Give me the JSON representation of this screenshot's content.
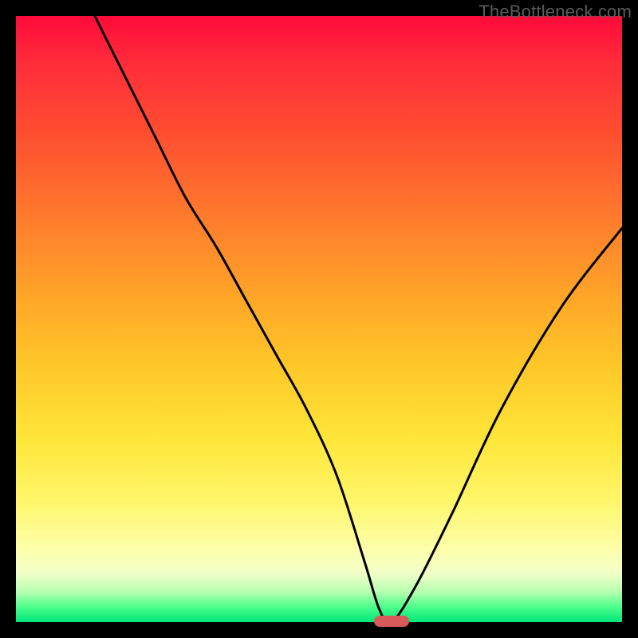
{
  "watermark": "TheBottleneck.com",
  "chart_data": {
    "type": "line",
    "title": "",
    "xlabel": "",
    "ylabel": "",
    "xlim": [
      0,
      100
    ],
    "ylim": [
      0,
      100
    ],
    "grid": false,
    "series": [
      {
        "name": "curve",
        "x": [
          13,
          18,
          23,
          28,
          33,
          38,
          43,
          48,
          53,
          57.5,
          60,
          62,
          66,
          72,
          80,
          90,
          100
        ],
        "y": [
          100,
          90,
          80,
          70,
          62,
          53,
          44,
          35,
          24,
          10,
          2,
          0,
          6,
          18,
          35,
          52,
          65
        ]
      }
    ],
    "marker": {
      "x": 62,
      "y": 0,
      "color": "#d95a5a"
    },
    "background_gradient": [
      "#ff0a3a",
      "#ff5030",
      "#ffa428",
      "#ffe63a",
      "#fdffaa",
      "#b7ffb0",
      "#00e67a"
    ]
  }
}
